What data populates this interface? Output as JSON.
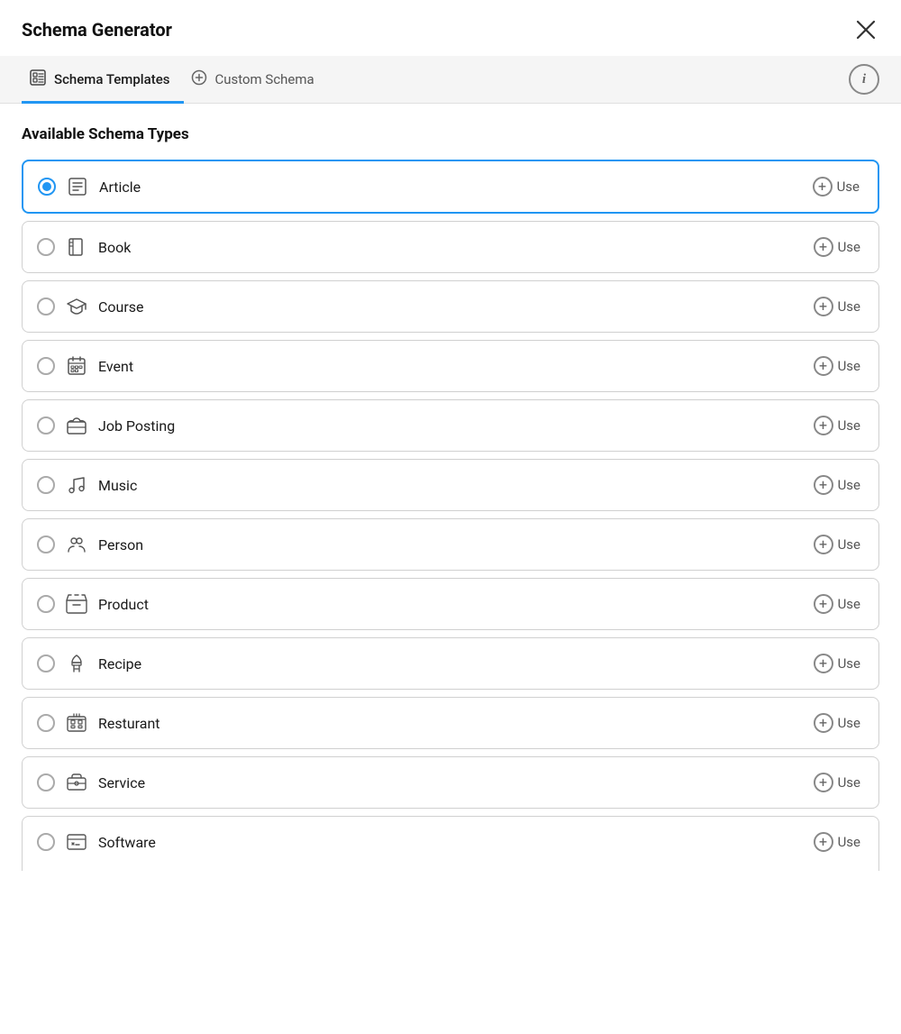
{
  "header": {
    "title": "Schema Generator",
    "close_label": "×"
  },
  "tabs": [
    {
      "id": "schema-templates",
      "label": "Schema Templates",
      "icon": "template-icon",
      "active": true
    },
    {
      "id": "custom-schema",
      "label": "Custom Schema",
      "icon": "plus-circle-icon",
      "active": false
    }
  ],
  "info_button_label": "i",
  "section_title": "Available Schema Types",
  "schema_types": [
    {
      "id": "article",
      "label": "Article",
      "selected": true,
      "icon": "article-icon"
    },
    {
      "id": "book",
      "label": "Book",
      "selected": false,
      "icon": "book-icon"
    },
    {
      "id": "course",
      "label": "Course",
      "selected": false,
      "icon": "course-icon"
    },
    {
      "id": "event",
      "label": "Event",
      "selected": false,
      "icon": "event-icon"
    },
    {
      "id": "job-posting",
      "label": "Job Posting",
      "selected": false,
      "icon": "job-posting-icon"
    },
    {
      "id": "music",
      "label": "Music",
      "selected": false,
      "icon": "music-icon"
    },
    {
      "id": "person",
      "label": "Person",
      "selected": false,
      "icon": "person-icon"
    },
    {
      "id": "product",
      "label": "Product",
      "selected": false,
      "icon": "product-icon"
    },
    {
      "id": "recipe",
      "label": "Recipe",
      "selected": false,
      "icon": "recipe-icon"
    },
    {
      "id": "resturant",
      "label": "Resturant",
      "selected": false,
      "icon": "restaurant-icon"
    },
    {
      "id": "service",
      "label": "Service",
      "selected": false,
      "icon": "service-icon"
    },
    {
      "id": "software",
      "label": "Software",
      "selected": false,
      "icon": "software-icon",
      "partial": true
    }
  ],
  "use_label": "Use"
}
